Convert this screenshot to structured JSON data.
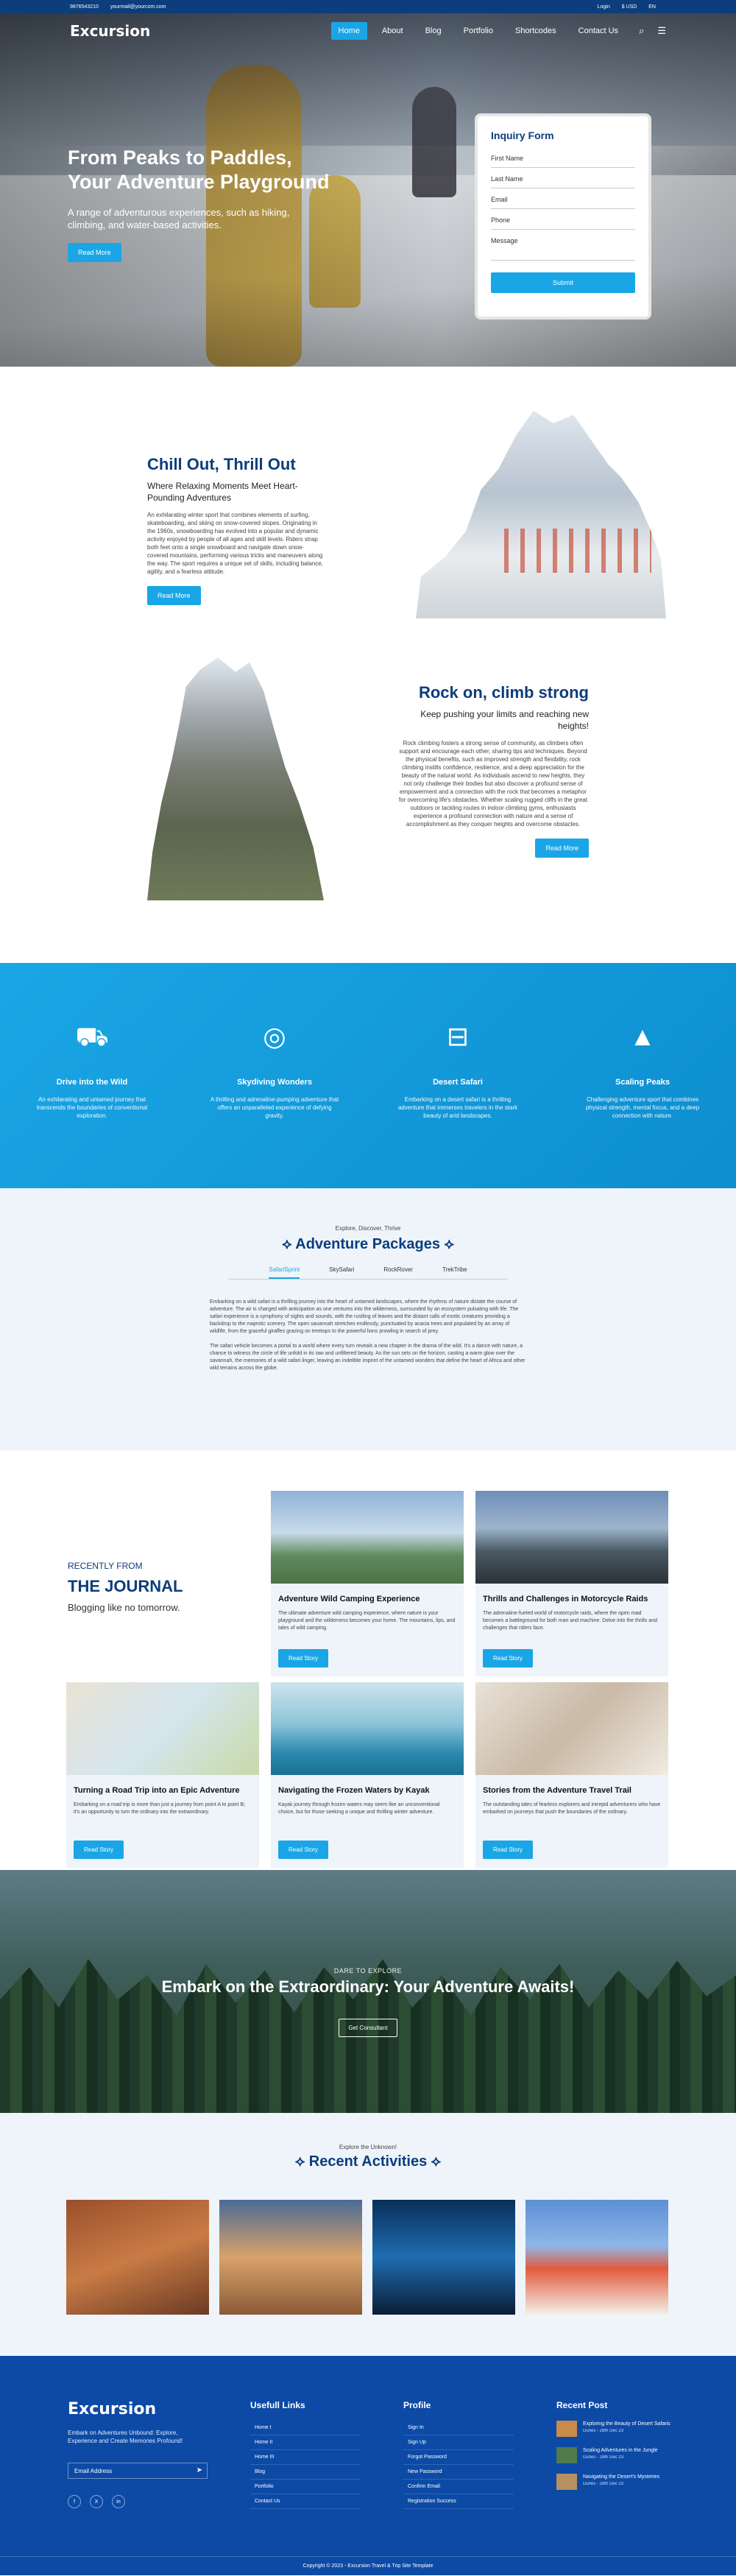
{
  "topbar": {
    "phone": "9876543210",
    "email": "yourmail@yourcom.com",
    "login": "Login",
    "currency": "$ USD",
    "lang": "EN"
  },
  "nav": {
    "logo": "Excursion",
    "items": [
      "Home",
      "About",
      "Blog",
      "Portfolio",
      "Shortcodes",
      "Contact Us"
    ],
    "active": "Home"
  },
  "hero": {
    "title_line1": "From Peaks to Paddles,",
    "title_line2": "Your Adventure Playground",
    "text": "A range of adventurous experiences, such as hiking, climbing, and water-based activities.",
    "button": "Read More"
  },
  "inquiry": {
    "title": "Inquiry Form",
    "fields": [
      "First Name",
      "Last Name",
      "Email",
      "Phone",
      "Message"
    ],
    "submit": "Submit"
  },
  "chill": {
    "title": "Chill Out, Thrill Out",
    "subtitle": "Where Relaxing Moments Meet Heart-Pounding Adventures",
    "text": "An exhilarating winter sport that combines elements of surfing, skateboarding, and skiing on snow-covered slopes. Originating in the 1960s, snowboarding has evolved into a popular and dynamic activity enjoyed by people of all ages and skill levels. Riders strap both feet onto a single snowboard and navigate down snow-covered mountains, performing various tricks and maneuvers along the way. The sport requires a unique set of skills, including balance, agility, and a fearless attitude.",
    "button": "Read More"
  },
  "rock": {
    "title": "Rock on, climb strong",
    "subtitle": "Keep pushing your limits and reaching new heights!",
    "text": "Rock climbing fosters a strong sense of community, as climbers often support and encourage each other, sharing tips and techniques. Beyond the physical benefits, such as improved strength and flexibility, rock climbing instills confidence, resilience, and a deep appreciation for the beauty of the natural world. As individuals ascend to new heights, they not only challenge their bodies but also discover a profound sense of empowerment and a connection with the rock that becomes a metaphor for overcoming life's obstacles. Whether scaling rugged cliffs in the great outdoors or tackling routes in indoor climbing gyms, enthusiasts experience a profound connection with nature and a sense of accomplishment as they conquer heights and overcome obstacles.",
    "button": "Read More"
  },
  "features": [
    {
      "icon": "road-icon",
      "glyph": "⛟",
      "title": "Drive into the Wild",
      "text": "An exhilarating and untamed journey that transcends the boundaries of conventional exploration."
    },
    {
      "icon": "globe-icon",
      "glyph": "◎",
      "title": "Skydiving Wonders",
      "text": "A thrilling and adrenaline-pumping adventure that offers an unparalleled experience of defying gravity."
    },
    {
      "icon": "car-icon",
      "glyph": "⊟",
      "title": "Desert Safari",
      "text": "Embarking on a desert safari is a thrilling adventure that immerses travelers in the stark beauty of arid landscapes."
    },
    {
      "icon": "mountain-icon",
      "glyph": "▲",
      "title": "Scaling Peaks",
      "text": "Challenging adventure sport that combines physical strength, mental focus, and a deep connection with nature."
    }
  ],
  "packages": {
    "kicker": "Explore, Discover, Thrive",
    "title": "Adventure Packages",
    "tabs": [
      "SafariSprint",
      "SkySafari",
      "RockRover",
      "TrekTribe"
    ],
    "p1": "Embarking on a wild safari is a thrilling journey into the heart of untamed landscapes, where the rhythms of nature dictate the course of adventure. The air is charged with anticipation as one ventures into the wilderness, surrounded by an ecosystem pulsating with life. The safari experience is a symphony of sights and sounds, with the rustling of leaves and the distant calls of exotic creatures providing a backdrop to the majestic scenery. The open savannah stretches endlessly, punctuated by acacia trees and populated by an array of wildlife, from the graceful giraffes grazing on treetops to the powerful lions prowling in search of prey.",
    "p2": "The safari vehicle becomes a portal to a world where every turn reveals a new chapter in the drama of the wild. It's a dance with nature, a chance to witness the circle of life unfold in its raw and unfiltered beauty. As the sun sets on the horizon, casting a warm glow over the savannah, the memories of a wild safari linger, leaving an indelible imprint of the untamed wonders that define the heart of Africa and other wild terrains across the globe."
  },
  "journal": {
    "kicker": "RECENTLY FROM",
    "title": "THE JOURNAL",
    "tagline": "Blogging like no tomorrow.",
    "cards": [
      {
        "title": "Adventure Wild Camping Experience",
        "text": "The ultimate adventure wild camping experience, where nature is your playground and the wilderness becomes your home. The mountains, lips, and tales of wild camping.",
        "button": "Read Story"
      },
      {
        "title": "Thrills and Challenges in Motorcycle Raids",
        "text": "The adrenaline-fueled world of motorcycle raids, where the open road becomes a battleground for both man and machine. Delve into the thrills and challenges that riders face.",
        "button": "Read Story"
      },
      {
        "title": "Turning a Road Trip into an Epic Adventure",
        "text": "Embarking on a road trip is more than just a journey from point A to point B; it's an opportunity to turn the ordinary into the extraordinary.",
        "button": "Read Story"
      },
      {
        "title": "Navigating the Frozen Waters by Kayak",
        "text": "Kayak journey through frozen waters may seem like an unconventional choice, but for those seeking a unique and thrilling winter adventure.",
        "button": "Read Story"
      },
      {
        "title": "Stories from the Adventure Travel Trail",
        "text": "The outstanding tales of fearless explorers and intrepid adventurers who have embarked on journeys that push the boundaries of the ordinary.",
        "button": "Read Story"
      }
    ]
  },
  "cta": {
    "kicker": "DARE TO EXPLORE",
    "title": "Embark on the Extraordinary: Your Adventure Awaits!",
    "button": "Get Consultant"
  },
  "recent": {
    "kicker": "Explore the Unknown!",
    "title": "Recent Activities"
  },
  "footer": {
    "logo": "Excursion",
    "about": "Embark on Adventures Unbound: Explore, Experience and Create Memories Profound!",
    "email": "Email Address",
    "social": [
      "f",
      "X",
      "in"
    ],
    "links_title": "Usefull Links",
    "links": [
      "Home I",
      "Home II",
      "Home III",
      "Blog",
      "Portfolio",
      "Contact Us"
    ],
    "profile_title": "Profile",
    "profile": [
      "Sign In",
      "Sign Up",
      "Forgot Password",
      "New Password",
      "Confirm Email",
      "Registration Success"
    ],
    "posts_title": "Recent Post",
    "posts": [
      {
        "title": "Exploring the Beauty of Desert Safaris",
        "date": "Dunes - 28th Dec 23"
      },
      {
        "title": "Scaling Adventures in the Jungle",
        "date": "Dunes - 28th Dec 23"
      },
      {
        "title": "Navigating the Desert's Mysteries",
        "date": "Dunes - 28th Dec 23"
      }
    ],
    "copyright": "Copyright © 2023 - Excursion Travel & Trip Site Template"
  }
}
